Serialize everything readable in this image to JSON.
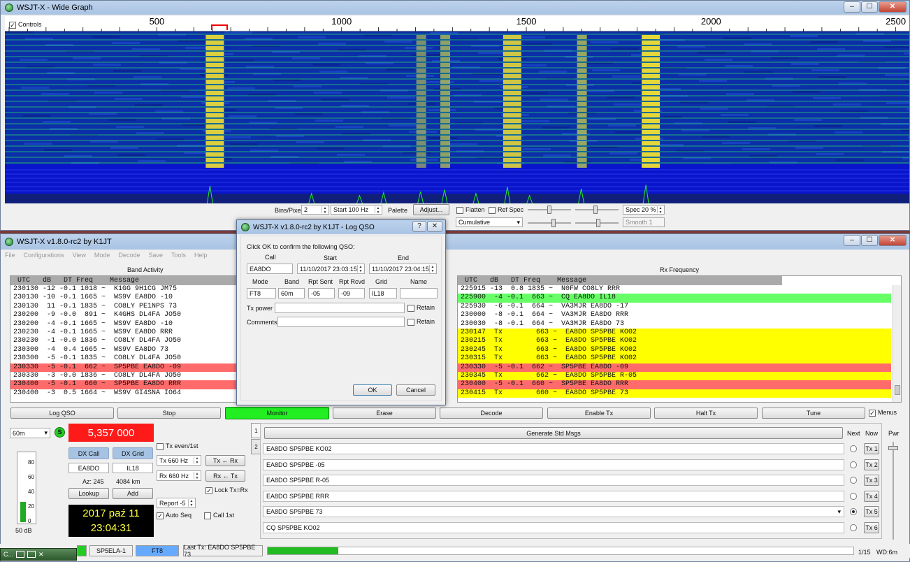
{
  "wide_graph": {
    "title": "WSJT-X - Wide Graph",
    "controls_label": "Controls",
    "freq_labels": [
      "500",
      "1000",
      "1500",
      "2000",
      "2500"
    ],
    "freq_values": [
      500,
      1000,
      1500,
      2000,
      2500
    ],
    "signal_columns": [
      {
        "f": 655,
        "strength": 0.9
      },
      {
        "f": 930,
        "strength": 0.5
      },
      {
        "f": 1060,
        "strength": 0.4
      },
      {
        "f": 1125,
        "strength": 0.55
      },
      {
        "f": 1225,
        "strength": 0.6
      },
      {
        "f": 1290,
        "strength": 0.7
      },
      {
        "f": 1375,
        "strength": 0.5
      },
      {
        "f": 1460,
        "strength": 0.85
      },
      {
        "f": 1520,
        "strength": 0.4
      },
      {
        "f": 1660,
        "strength": 0.75
      },
      {
        "f": 1835,
        "strength": 0.95
      }
    ],
    "bins_label": "Bins/Pixel",
    "bins_value": "2",
    "start_label": "Start 100 Hz",
    "palette_label": "Palette",
    "adjust_label": "Adjust...",
    "flatten_label": "Flatten",
    "refspec_label": "Ref Spec",
    "spec_label": "Spec 20 %",
    "cumulative_label": "Cumulative",
    "smooth_label": "Smooth  1"
  },
  "main": {
    "title": "WSJT-X   v1.8.0-rc2   by K1JT",
    "menu": [
      "File",
      "Configurations",
      "View",
      "Mode",
      "Decode",
      "Save",
      "Tools",
      "Help"
    ],
    "band_activity_title": "Band Activity",
    "rx_frequency_title": "Rx Frequency",
    "band_header": " UTC   dB   DT Freq    Message",
    "rx_header": " UTC   dB   DT Freq    Message",
    "band_rows": [
      {
        "t": "230130 -12 -0.1 1018 ~  K1GG 9H1CG JM75",
        "c": "#ffffff"
      },
      {
        "t": "230130 -10 -0.1 1665 ~  WS9V EA8DO -10",
        "c": "#ffffff"
      },
      {
        "t": "230130  11 -0.1 1835 ~  CO8LY PE1NPS 73",
        "c": "#ffffff"
      },
      {
        "t": "230200  -9 -0.0  891 ~  K4GHS DL4FA JO50",
        "c": "#ffffff"
      },
      {
        "t": "230200  -4 -0.1 1665 ~  WS9V EA8DO -10",
        "c": "#ffffff"
      },
      {
        "t": "230230  -4 -0.1 1665 ~  WS9V EA8DO RRR",
        "c": "#ffffff"
      },
      {
        "t": "230230  -1 -0.0 1836 ~  CO8LY DL4FA JO50",
        "c": "#ffffff"
      },
      {
        "t": "230300  -4  0.4 1665 ~  WS9V EA8DO 73",
        "c": "#ffffff"
      },
      {
        "t": "230300  -5 -0.1 1835 ~  CO8LY DL4FA JO50",
        "c": "#ffffff"
      },
      {
        "t": "230330  -5 -0.1  662 ~  SP5PBE EA8DO -09",
        "c": "#ff6b6b"
      },
      {
        "t": "230330  -3 -0.0 1836 ~  CO8LY DL4FA JO50",
        "c": "#ffffff"
      },
      {
        "t": "230400  -5 -0.1  660 ~  SP5PBE EA8DO RRR",
        "c": "#ff6b6b"
      },
      {
        "t": "230400  -3  0.5 1664 ~  WS9V GI4SNA IO64",
        "c": "#ffffff"
      }
    ],
    "rx_rows": [
      {
        "t": "225915 -13  0.8 1835 ~  N0FW CO8LY RRR",
        "c": "#ffffff"
      },
      {
        "t": "225900  -4 -0.1  663 ~  CQ EA8DO IL18",
        "c": "#66ff66"
      },
      {
        "t": "225930  -6 -0.1  664 ~  VA3MJR EA8DO -17",
        "c": "#ffffff"
      },
      {
        "t": "230000  -8 -0.1  664 ~  VA3MJR EA8DO RRR",
        "c": "#ffffff"
      },
      {
        "t": "230030  -8 -0.1  664 ~  VA3MJR EA8DO 73",
        "c": "#ffffff"
      },
      {
        "t": "230147  Tx        663 ~  EA8DO SP5PBE KO02",
        "c": "#ffff00"
      },
      {
        "t": "230215  Tx        663 ~  EA8DO SP5PBE KO02",
        "c": "#ffff00"
      },
      {
        "t": "230245  Tx        663 ~  EA8DO SP5PBE KO02",
        "c": "#ffff00"
      },
      {
        "t": "230315  Tx        663 ~  EA8DO SP5PBE KO02",
        "c": "#ffff00"
      },
      {
        "t": "230330  -5 -0.1  662 ~  SP5PBE EA8DO -09",
        "c": "#ff6b6b"
      },
      {
        "t": "230345  Tx        662 ~  EA8DO SP5PBE R-05",
        "c": "#ffff00"
      },
      {
        "t": "230400  -5 -0.1  660 ~  SP5PBE EA8DO RRR",
        "c": "#ff6b6b"
      },
      {
        "t": "230415  Tx        660 ~  EA8DO SP5PBE 73",
        "c": "#ffff00"
      }
    ],
    "buttons": {
      "log_qso": "Log QSO",
      "stop": "Stop",
      "monitor": "Monitor",
      "erase": "Erase",
      "decode": "Decode",
      "enable_tx": "Enable Tx",
      "halt_tx": "Halt Tx",
      "tune": "Tune",
      "menus": "Menus"
    },
    "band": "60m",
    "s_badge": "S",
    "frequency": "5,357 000",
    "dx_call_label": "DX Call",
    "dx_grid_label": "DX Grid",
    "dx_call": "EA8DO",
    "dx_grid": "IL18",
    "az": "Az: 245",
    "dist": "4084 km",
    "lookup": "Lookup",
    "add": "Add",
    "date": "2017 paź 11",
    "time": "23:04:31",
    "meter_ticks": [
      "80",
      "60",
      "40",
      "20",
      "0"
    ],
    "meter_label": "50 dB",
    "meter_level": 0.28,
    "tx_even": "Tx even/1st",
    "tx_hz": "Tx  660  Hz",
    "rx_hz": "Rx  660  Hz",
    "tx_from_rx": "Tx ← Rx",
    "rx_from_tx": "Rx ← Tx",
    "lock": "Lock Tx=Rx",
    "report": "Report -5",
    "auto_seq": "Auto Seq",
    "call_1st": "Call 1st",
    "tab1": "1",
    "tab2": "2",
    "gen_msgs": "Generate Std Msgs",
    "next_label": "Next",
    "now_label": "Now",
    "pwr_label": "Pwr",
    "tx_msgs": [
      {
        "msg": "EA8DO SP5PBE KO02",
        "btn": "Tx 1"
      },
      {
        "msg": "EA8DO SP5PBE -05",
        "btn": "Tx 2"
      },
      {
        "msg": "EA8DO SP5PBE R-05",
        "btn": "Tx 3"
      },
      {
        "msg": "EA8DO SP5PBE RRR",
        "btn": "Tx 4"
      },
      {
        "msg": "EA8DO SP5PBE 73",
        "btn": "Tx 5"
      },
      {
        "msg": "CQ SP5PBE KO02",
        "btn": "Tx 6"
      }
    ],
    "status": {
      "callsign": "SP5ELA-1",
      "mode": "FT8",
      "last_tx": "Last Tx: EA8DO SP5PBE 73",
      "progress": "1/15",
      "wd": "WD:6m",
      "progress_fraction": 0.12
    }
  },
  "dialog": {
    "title": "WSJT-X   v1.8.0-rc2   by K1JT - Log QSO",
    "help": "?",
    "close": "✕",
    "prompt": "Click OK to confirm the following QSO:",
    "call_label": "Call",
    "start_label": "Start",
    "end_label": "End",
    "call": "EA8DO",
    "start": "11/10/2017 23:03:15",
    "end": "11/10/2017 23:04:15",
    "mode_label": "Mode",
    "band_label": "Band",
    "sent_label": "Rpt Sent",
    "rcvd_label": "Rpt Rcvd",
    "grid_label": "Grid",
    "name_label": "Name",
    "mode": "FT8",
    "band": "60m",
    "sent": "-05",
    "rcvd": "-09",
    "grid": "IL18",
    "name": "",
    "txpower_label": "Tx power",
    "comments_label": "Comments",
    "retain_label": "Retain",
    "ok": "OK",
    "cancel": "Cancel"
  },
  "taskbar": {
    "item": "C..."
  }
}
